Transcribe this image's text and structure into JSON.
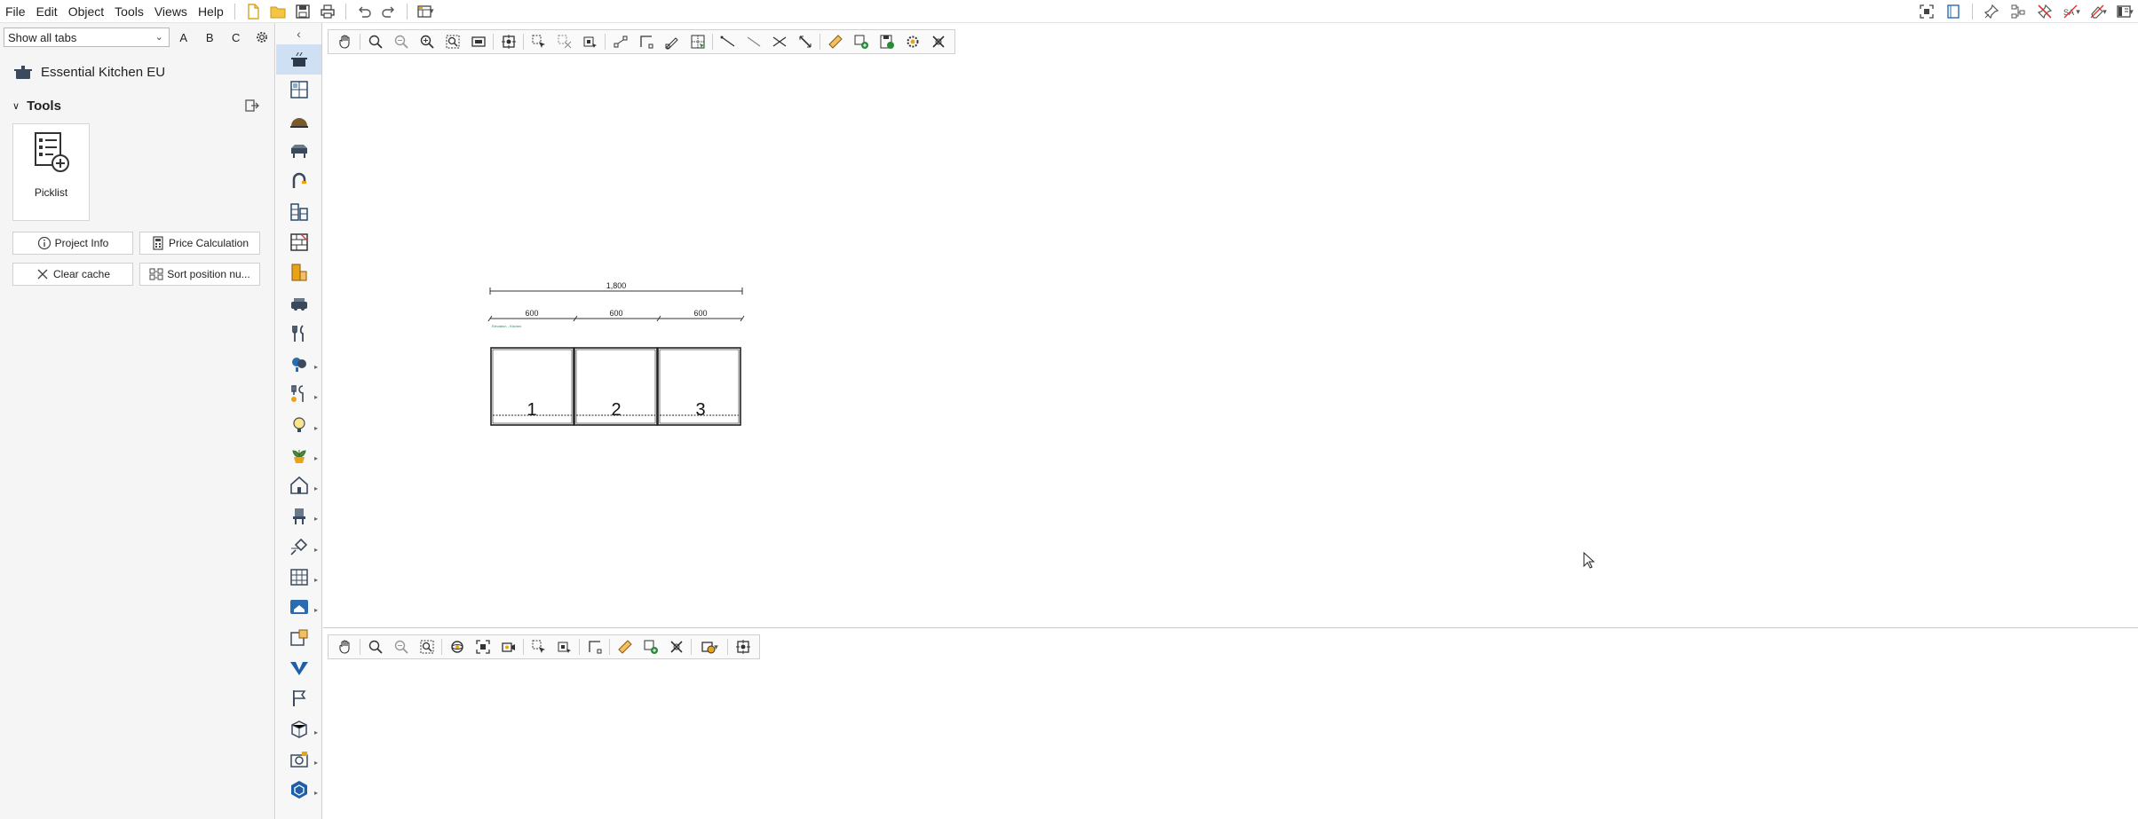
{
  "menu": {
    "items": [
      "File",
      "Edit",
      "Object",
      "Tools",
      "Views",
      "Help"
    ]
  },
  "left_panel": {
    "tab_select_value": "Show all tabs",
    "letter_buttons": [
      "A",
      "B",
      "C"
    ],
    "catalog_title": "Essential Kitchen EU",
    "tools_header": "Tools",
    "picklist_label": "Picklist",
    "buttons": {
      "project_info": "Project Info",
      "price_calculation": "Price Calculation",
      "clear_cache": "Clear cache",
      "sort_position": "Sort position nu..."
    }
  },
  "plan": {
    "total_dimension": "1,800",
    "segment_dimensions": [
      "600",
      "600",
      "600"
    ],
    "small_note": "Elevation - Kitchen",
    "cabinet_numbers": [
      "1",
      "2",
      "3"
    ]
  },
  "colors": {
    "accent": "#cfe0f4",
    "note_green": "#2e8b57"
  }
}
